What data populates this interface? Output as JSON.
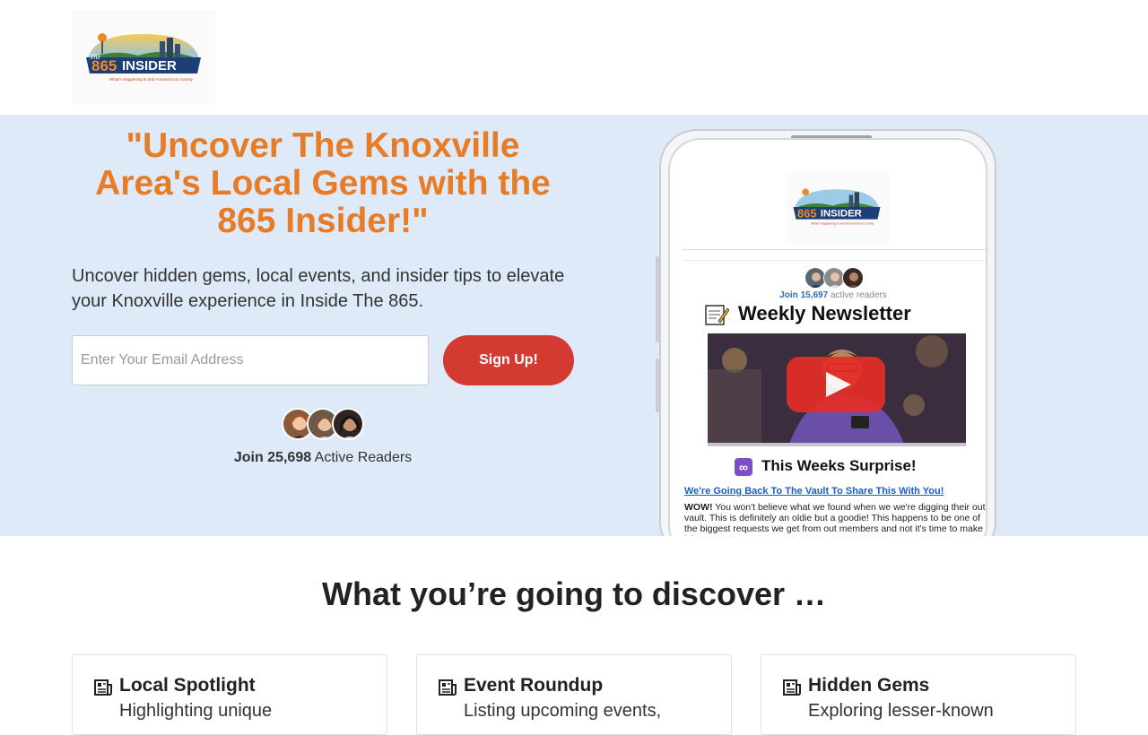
{
  "header": {
    "logo_text": "The 865 INSIDER",
    "logo_tagline": "What's Happening In and Around Knox County"
  },
  "hero": {
    "title": "\"Uncover The Knoxville Area's Local Gems with the 865 Insider!\"",
    "subtitle": "Uncover hidden gems, local events, and insider tips to elevate your Knoxville experience in Inside The 865.",
    "email_placeholder": "Enter Your Email Address",
    "signup_label": "Sign Up!",
    "readers_prefix": "Join",
    "readers_count": "25,698",
    "readers_suffix": "Active Readers"
  },
  "phone": {
    "readers_prefix": "Join",
    "readers_count": "15,697",
    "readers_suffix": "active readers",
    "newsletter_title": "Weekly Newsletter",
    "surprise_title": "This Weeks Surprise!",
    "link_text": "We're Going Back To The Vault To Share This With You!",
    "body_bold": "WOW!",
    "body_text": " You won't believe what we found when we we're digging their out vault.  This is definitely an oldie but a goodie!  This happens to be one of the biggest requests we get from out members and not it's time to make it happen!"
  },
  "discover": {
    "title": "What you’re going to discover …",
    "cards": [
      {
        "title": "Local Spotlight",
        "desc": "Highlighting unique"
      },
      {
        "title": "Event Roundup",
        "desc": "Listing upcoming events,"
      },
      {
        "title": "Hidden Gems",
        "desc": "Exploring lesser-known"
      }
    ]
  },
  "colors": {
    "accent_orange": "#e87b25",
    "hero_bg": "#deeaf7",
    "button_red": "#d33a32",
    "link_blue": "#1a5fc4"
  },
  "icons": {
    "card_icon": "newspaper-icon",
    "newsletter_icon": "notepad-icon",
    "surprise_icon": "infinity-icon",
    "video_icon": "play-icon"
  }
}
